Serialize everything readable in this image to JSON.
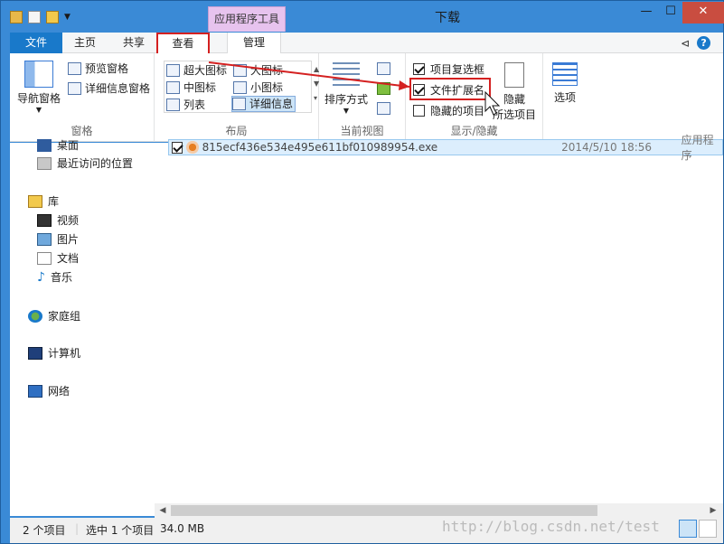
{
  "window": {
    "title": "下载",
    "tool_tab": "应用程序工具",
    "controls": {
      "minimize": "—",
      "maximize": "☐",
      "close": "✕"
    }
  },
  "ribbon_tabs": {
    "file": "文件",
    "home": "主页",
    "share": "共享",
    "view": "查看",
    "manage": "管理"
  },
  "panes_group": {
    "label": "窗格",
    "nav_pane": "导航窗格",
    "preview_pane": "预览窗格",
    "details_pane": "详细信息窗格"
  },
  "layout_group": {
    "label": "布局",
    "extra_large": "超大图标",
    "large": "大图标",
    "medium": "中图标",
    "small": "小图标",
    "list": "列表",
    "details": "详细信息"
  },
  "current_view_group": {
    "label": "当前视图",
    "sort_by": "排序方式"
  },
  "show_hide_group": {
    "label": "显示/隐藏",
    "item_checkboxes": "项目复选框",
    "file_extensions": "文件扩展名",
    "hidden_items": "隐藏的项目",
    "hide_selected_1": "隐藏",
    "hide_selected_2": "所选项目"
  },
  "options": "选项",
  "nav": {
    "desktop": "桌面",
    "recent": "最近访问的位置",
    "library": "库",
    "videos": "视频",
    "pictures": "图片",
    "documents": "文档",
    "music": "音乐",
    "homegroup": "家庭组",
    "computer": "计算机",
    "network": "网络"
  },
  "file": {
    "name": "815ecf436e534e495e611bf010989954.exe",
    "date": "2014/5/10 18:56",
    "type": "应用程序"
  },
  "status": {
    "count": "2 个项目",
    "selected": "选中 1 个项目",
    "size": "34.0 MB"
  },
  "watermark": "http://blog.csdn.net/test",
  "colors": {
    "titlebar": "#3a8ad6",
    "file_tab": "#1979ca",
    "highlight": "#d42020",
    "tool_tab": "#e7c3ee"
  }
}
